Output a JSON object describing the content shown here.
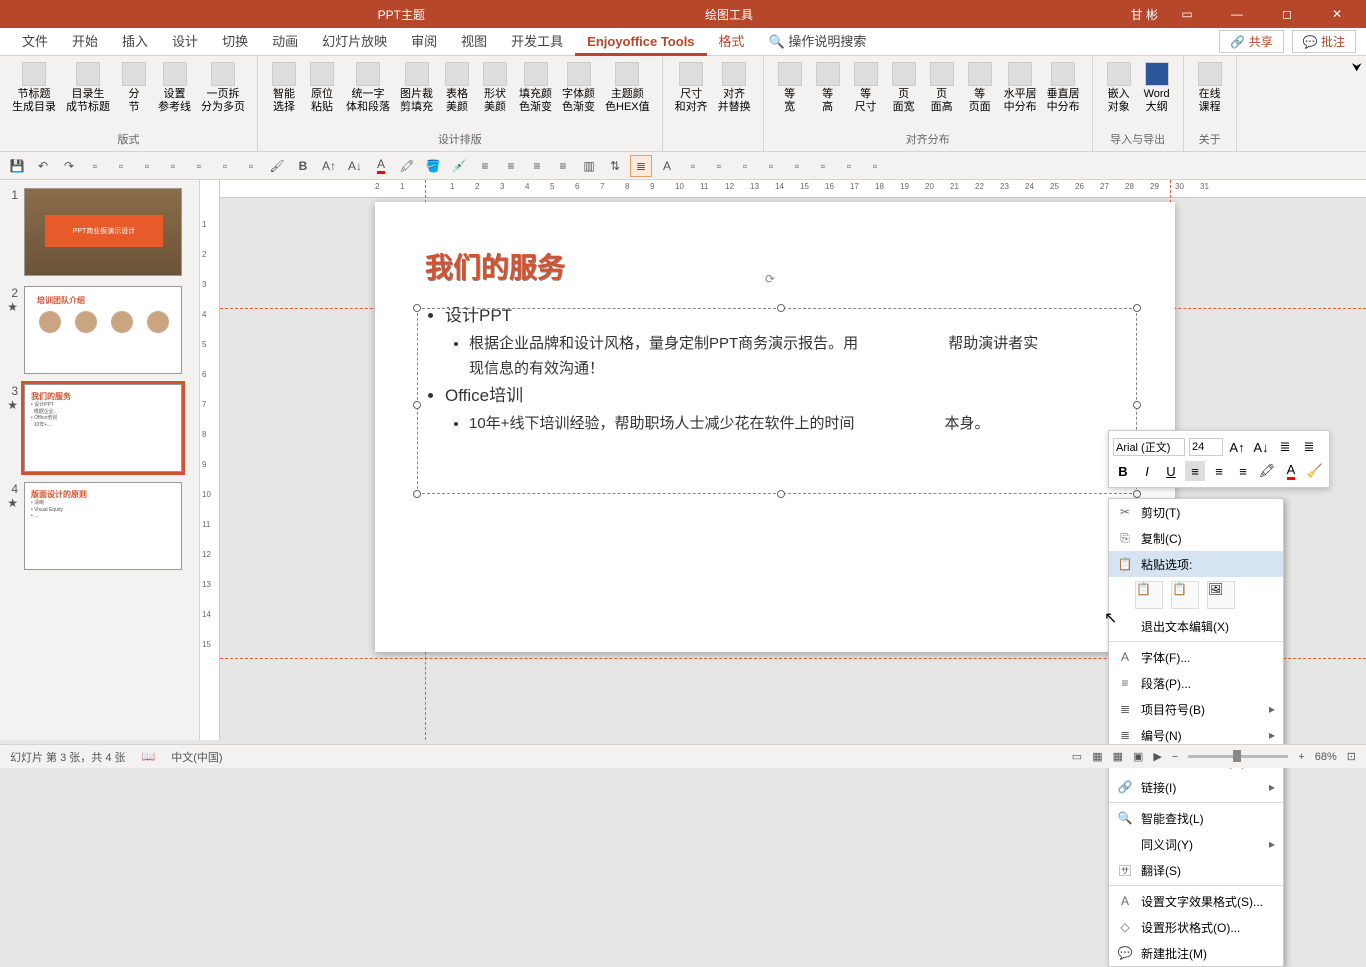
{
  "title": {
    "doc": "PPT主题",
    "context": "绘图工具",
    "user": "甘 彬"
  },
  "tabs": {
    "file": "文件",
    "home": "开始",
    "insert": "插入",
    "design": "设计",
    "transition": "切换",
    "animation": "动画",
    "slideshow": "幻灯片放映",
    "review": "审阅",
    "view": "视图",
    "developer": "开发工具",
    "enjoyoffice": "Enjoyoffice Tools",
    "format": "格式",
    "search": "操作说明搜索",
    "share": "共享",
    "comment": "批注"
  },
  "ribbon": {
    "g1": {
      "b1": "节标题\n生成目录",
      "b2": "目录生\n成节标题",
      "b3": "分\n节",
      "b4": "设置\n参考线",
      "b5": "一页拆\n分为多页",
      "title": "版式"
    },
    "g2": {
      "b1": "智能\n选择",
      "b2": "原位\n粘贴",
      "b3": "统一字\n体和段落",
      "b4": "图片裁\n剪填充",
      "b5": "表格\n美颜",
      "b6": "形状\n美颜",
      "b7": "填充颜\n色渐变",
      "b8": "字体颜\n色渐变",
      "b9": "主题颜\n色HEX值",
      "title": "设计排版"
    },
    "g3": {
      "b1": "尺寸\n和对齐",
      "b2": "对齐\n并替换",
      "title": ""
    },
    "g4": {
      "b1": "等\n宽",
      "b2": "等\n高",
      "b3": "等\n尺寸",
      "b4": "页\n面宽",
      "b5": "页\n面高",
      "b6": "等\n页面",
      "b7": "水平居\n中分布",
      "b8": "垂直居\n中分布",
      "title": "对齐分布"
    },
    "g5": {
      "b1": "嵌入\n对象",
      "b2": "Word\n大纲",
      "title": "导入与导出"
    },
    "g6": {
      "b1": "在线\n课程",
      "title": "关于"
    }
  },
  "slide": {
    "title": "我们的服务",
    "b1": "设计PPT",
    "b1a": "根据企业品牌和设计风格，量身定制PPT商务演示报告。用",
    "b1a2": "帮助演讲者实",
    "b1b": "现信息的有效沟通！",
    "b2": "Office培训",
    "b2a": "10年+线下培训经验，帮助职场人士减少花在软件上的时间",
    "b2a2": "本身。"
  },
  "float": {
    "font": "Arial (正文)",
    "size": "24"
  },
  "ctx": {
    "cut": "剪切(T)",
    "copy": "复制(C)",
    "pasteopt": "粘贴选项:",
    "exittext": "退出文本编辑(X)",
    "font": "字体(F)...",
    "para": "段落(P)...",
    "bullet": "项目符号(B)",
    "number": "编号(N)",
    "smartart": "转换为 SmartArt(M)",
    "link": "链接(I)",
    "smartlookup": "智能查找(L)",
    "synonym": "同义词(Y)",
    "translate": "翻译(S)",
    "texteffect": "设置文字效果格式(S)...",
    "shapeformat": "设置形状格式(O)...",
    "newcomment": "新建批注(M)"
  },
  "status": {
    "slide": "幻灯片 第 3 张，共 4 张",
    "lang": "中文(中国)",
    "zoom": "68%"
  },
  "thumbs": {
    "t1": "PPT商业板演示设计",
    "t3": "我们的服务"
  }
}
